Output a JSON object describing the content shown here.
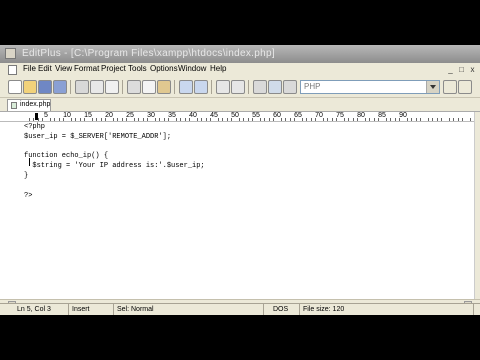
{
  "window": {
    "title": "EditPlus - [C:\\Program Files\\xampp\\htdocs\\index.php]"
  },
  "menu": {
    "items": [
      "File",
      "Edit",
      "View",
      "Format",
      "Project",
      "Tools",
      "Options",
      "Window",
      "Help"
    ],
    "window_controls": [
      "_",
      "□",
      "x"
    ]
  },
  "toolbar": {
    "buttons": [
      "new-file",
      "open",
      "save",
      "save-all",
      "print",
      "print-preview",
      "spell-check",
      "cut",
      "copy",
      "paste",
      "undo",
      "redo",
      "find",
      "replace",
      "find-in-files",
      "cliptext",
      "directory",
      "browser",
      "word-wrap",
      "ruler",
      "line-numbers"
    ],
    "language": "PHP"
  },
  "tabs": [
    {
      "label": "index.php"
    }
  ],
  "ruler": {
    "labels": [
      "5",
      "10",
      "15",
      "20",
      "25",
      "30",
      "35",
      "40",
      "45",
      "50",
      "55",
      "60",
      "65",
      "70",
      "75",
      "80",
      "85",
      "90"
    ]
  },
  "editor": {
    "lines": [
      "<?php",
      "$user_ip = $_SERVER['REMOTE_ADDR'];",
      "",
      "function echo_ip() {",
      "  $string = 'Your IP address is:'.$user_ip;",
      "}",
      "",
      "?>"
    ]
  },
  "statusbar": {
    "position": "Ln 5, Col 3",
    "mode": "Insert",
    "selection": "Sel: Normal",
    "format": "DOS",
    "file_size": "File size: 120"
  }
}
